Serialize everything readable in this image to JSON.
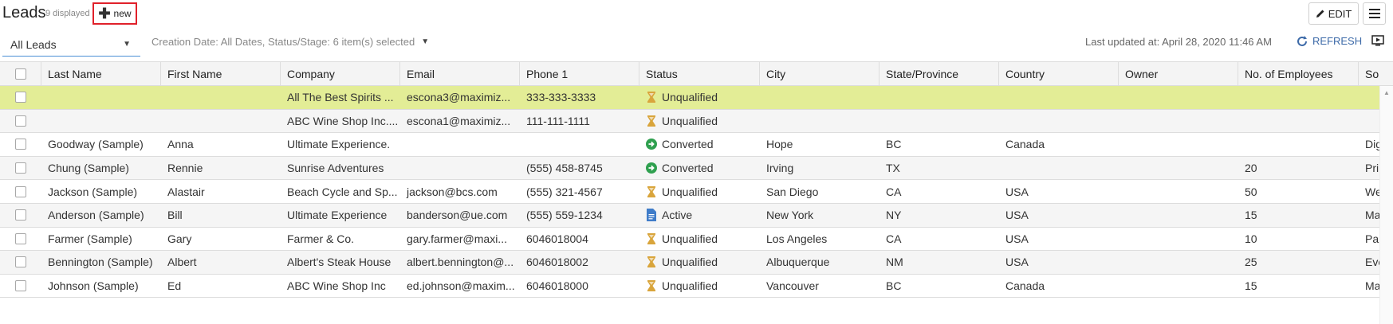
{
  "header": {
    "title": "Leads",
    "count_text": "9 displayed",
    "new_label": "new",
    "edit_label": "EDIT"
  },
  "filters": {
    "view_name": "All Leads",
    "summary": "Creation Date: All Dates, Status/Stage: 6 item(s) selected",
    "last_updated": "Last updated at: April 28, 2020 11:46 AM",
    "refresh_label": "REFRESH"
  },
  "colors": {
    "highlight_row": "#e3ed96",
    "alt_row": "#f5f5f5",
    "accent_blue": "#3d6aa8",
    "new_border": "#e0202a",
    "status_hourglass": "#d9a53c",
    "status_converted": "#2fa04f",
    "status_active": "#3f7cc9"
  },
  "table": {
    "columns": [
      "Last Name",
      "First Name",
      "Company",
      "Email",
      "Phone 1",
      "Status",
      "City",
      "State/Province",
      "Country",
      "Owner",
      "No. of Employees",
      "So"
    ],
    "rows": [
      {
        "last": "",
        "first": "",
        "company": "All The Best Spirits ...",
        "email": "escona3@maximiz...",
        "phone": "333-333-3333",
        "status": "Unqualified",
        "status_icon": "hourglass-icon",
        "city": "",
        "state": "",
        "country": "",
        "owner": "",
        "employees": "",
        "source": ""
      },
      {
        "last": "",
        "first": "",
        "company": "ABC Wine Shop Inc....",
        "email": "escona1@maximiz...",
        "phone": "111-111-1111",
        "status": "Unqualified",
        "status_icon": "hourglass-icon",
        "city": "",
        "state": "",
        "country": "",
        "owner": "",
        "employees": "",
        "source": ""
      },
      {
        "last": "Goodway (Sample)",
        "first": "Anna",
        "company": "Ultimate Experience.",
        "email": "",
        "phone": "",
        "status": "Converted",
        "status_icon": "arrow-circle-icon",
        "city": "Hope",
        "state": "BC",
        "country": "Canada",
        "owner": "",
        "employees": "",
        "source": "Dig"
      },
      {
        "last": "Chung (Sample)",
        "first": "Rennie",
        "company": "Sunrise Adventures",
        "email": "",
        "phone": "(555) 458-8745",
        "status": "Converted",
        "status_icon": "arrow-circle-icon",
        "city": "Irving",
        "state": "TX",
        "country": "",
        "owner": "",
        "employees": "20",
        "source": "Pri"
      },
      {
        "last": "Jackson (Sample)",
        "first": "Alastair",
        "company": "Beach Cycle and Sp...",
        "email": "jackson@bcs.com",
        "phone": "(555) 321-4567",
        "status": "Unqualified",
        "status_icon": "hourglass-icon",
        "city": "San Diego",
        "state": "CA",
        "country": "USA",
        "owner": "",
        "employees": "50",
        "source": "We"
      },
      {
        "last": "Anderson (Sample)",
        "first": "Bill",
        "company": "Ultimate Experience",
        "email": "banderson@ue.com",
        "phone": "(555) 559-1234",
        "status": "Active",
        "status_icon": "document-icon",
        "city": "New York",
        "state": "NY",
        "country": "USA",
        "owner": "",
        "employees": "15",
        "source": "Ma"
      },
      {
        "last": "Farmer (Sample)",
        "first": "Gary",
        "company": "Farmer & Co.",
        "email": "gary.farmer@maxi...",
        "phone": "6046018004",
        "status": "Unqualified",
        "status_icon": "hourglass-icon",
        "city": "Los Angeles",
        "state": "CA",
        "country": "USA",
        "owner": "",
        "employees": "10",
        "source": "Pa"
      },
      {
        "last": "Bennington (Sample)",
        "first": "Albert",
        "company": "Albert's Steak House",
        "email": "albert.bennington@...",
        "phone": "6046018002",
        "status": "Unqualified",
        "status_icon": "hourglass-icon",
        "city": "Albuquerque",
        "state": "NM",
        "country": "USA",
        "owner": "",
        "employees": "25",
        "source": "Eve"
      },
      {
        "last": "Johnson (Sample)",
        "first": "Ed",
        "company": "ABC Wine Shop Inc",
        "email": "ed.johnson@maxim...",
        "phone": "6046018000",
        "status": "Unqualified",
        "status_icon": "hourglass-icon",
        "city": "Vancouver",
        "state": "BC",
        "country": "Canada",
        "owner": "",
        "employees": "15",
        "source": "Ma"
      }
    ]
  }
}
